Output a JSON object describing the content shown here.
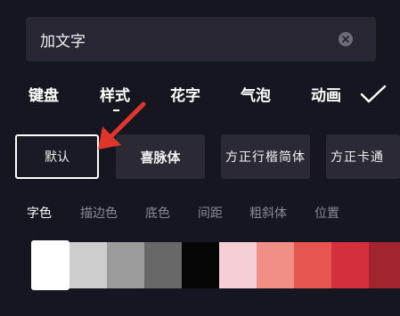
{
  "text_input": {
    "value": "加文字"
  },
  "tabs": [
    {
      "label": "键盘"
    },
    {
      "label": "样式"
    },
    {
      "label": "花字"
    },
    {
      "label": "气泡"
    },
    {
      "label": "动画"
    }
  ],
  "active_tab": "样式",
  "fonts": [
    {
      "label": "默认"
    },
    {
      "label": "喜脉体"
    },
    {
      "label": "方正行楷简体"
    },
    {
      "label": "方正卡通"
    }
  ],
  "selected_font": "默认",
  "subtabs": [
    {
      "label": "字色"
    },
    {
      "label": "描边色"
    },
    {
      "label": "底色"
    },
    {
      "label": "间距"
    },
    {
      "label": "粗斜体"
    },
    {
      "label": "位置"
    }
  ],
  "active_subtab": "字色",
  "colors": {
    "background": "#161620",
    "input_background": "#272632",
    "card_background": "#2a2934",
    "annotation_arrow": "#e0352c",
    "swatches": [
      "#ffffff",
      "#cdcdcd",
      "#9b9b9b",
      "#686868",
      "#050505",
      "#f6cfd6",
      "#ef8f86",
      "#e7574f",
      "#d42f3c",
      "#a2242f"
    ]
  },
  "selected_swatch": "#ffffff",
  "icons": {
    "clear": "clear-icon",
    "confirm": "checkmark-icon"
  }
}
